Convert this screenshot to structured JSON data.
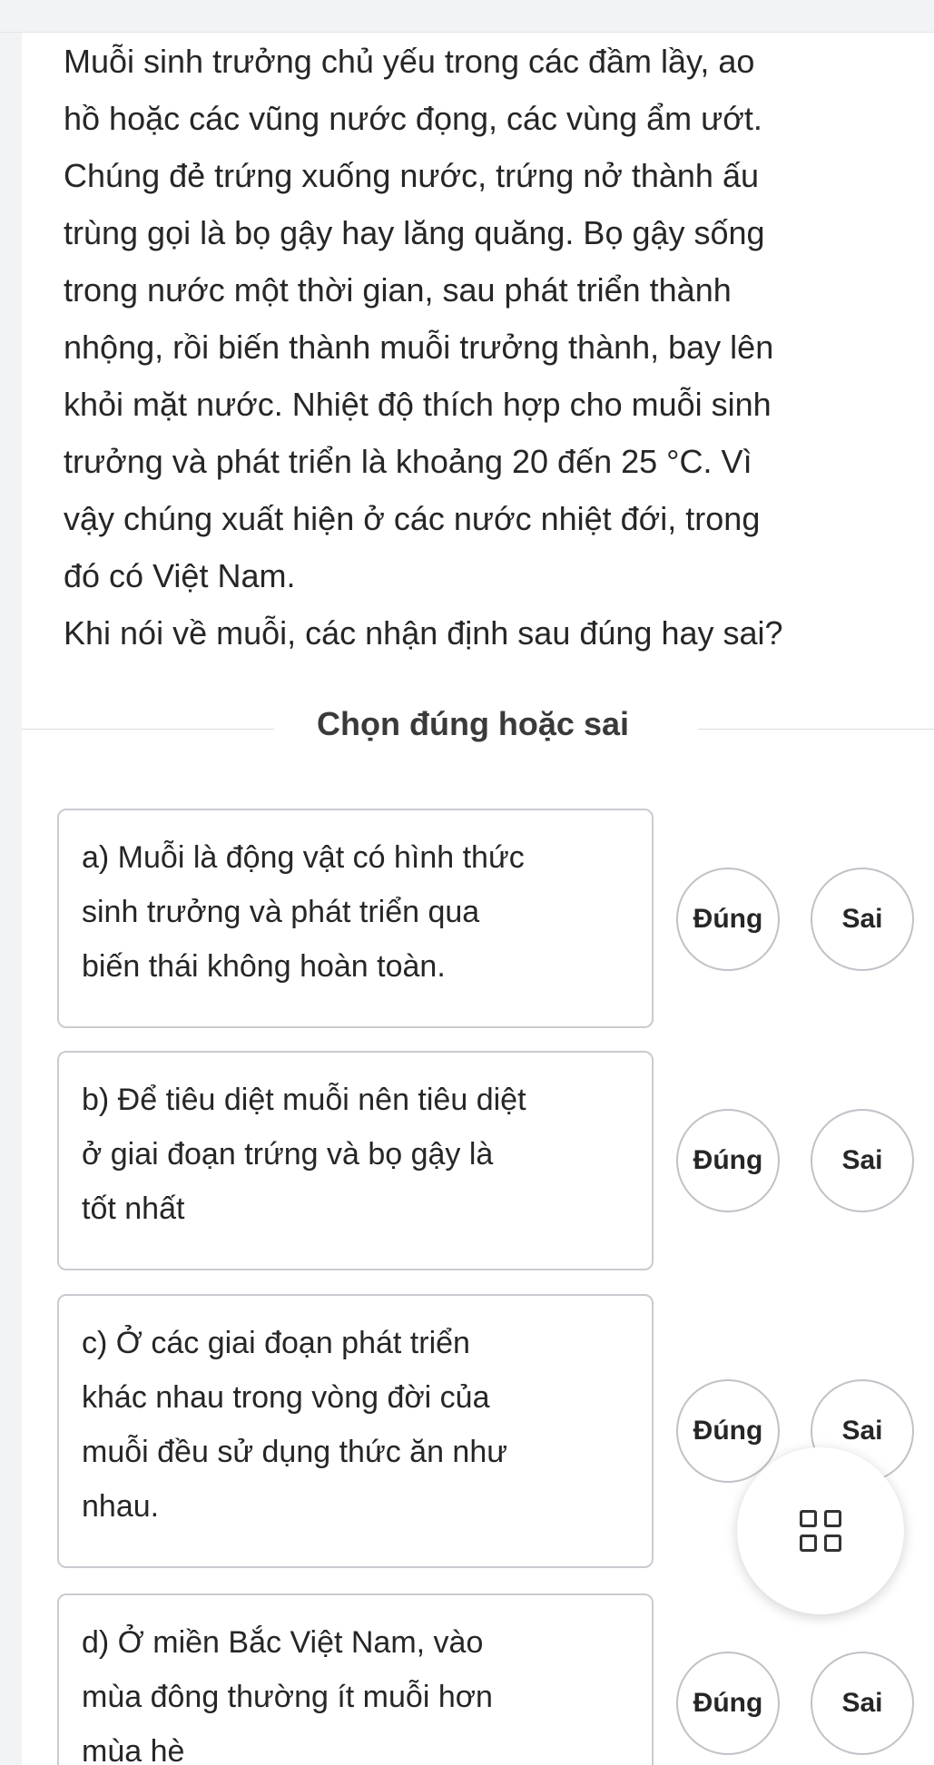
{
  "passage": {
    "lines": [
      "Muỗi sinh trưởng chủ yếu trong các đầm lầy, ao",
      "hồ hoặc các vũng nước đọng, các vùng ẩm ướt.",
      "Chúng đẻ trứng xuống nước, trứng nở thành ấu",
      "trùng gọi là bọ gậy hay lăng quăng. Bọ gậy sống",
      "trong nước một thời gian, sau phát triển thành",
      "nhộng, rồi biến thành muỗi trưởng thành, bay lên",
      "khỏi mặt nước. Nhiệt độ thích hợp cho muỗi sinh",
      "trưởng và phát triển là khoảng 20 đến 25 °C. Vì",
      "vậy chúng xuất hiện ở các nước nhiệt đới, trong",
      "đó có Việt Nam.",
      "Khi nói về muỗi, các nhận định sau đúng hay sai?"
    ]
  },
  "section": {
    "title": "Chọn đúng hoặc sai"
  },
  "statements": [
    {
      "lines": [
        "a) Muỗi là động vật có hình thức",
        "sinh trưởng và phát triển qua",
        "biến thái không hoàn toàn."
      ],
      "true_label": "Đúng",
      "false_label": "Sai"
    },
    {
      "lines": [
        "b) Để tiêu diệt muỗi nên tiêu diệt",
        "ở giai đoạn trứng và bọ gậy là",
        "tốt nhất"
      ],
      "true_label": "Đúng",
      "false_label": "Sai"
    },
    {
      "lines": [
        "c) Ở các giai đoạn phát triển",
        "khác nhau trong vòng đời của",
        "muỗi đều sử dụng thức ăn như",
        "nhau."
      ],
      "true_label": "Đúng",
      "false_label": "Sai"
    },
    {
      "lines": [
        "d) Ở miền Bắc Việt Nam, vào",
        "mùa đông thường ít muỗi hơn",
        "mùa hè"
      ],
      "true_label": "Đúng",
      "false_label": "Sai"
    }
  ],
  "fab": {
    "icon": "grid-icon"
  }
}
